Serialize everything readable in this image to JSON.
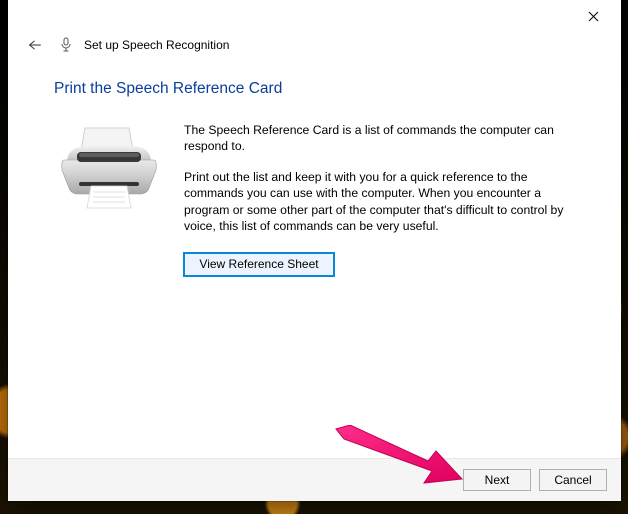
{
  "window": {
    "title": "Set up Speech Recognition"
  },
  "page": {
    "heading": "Print the Speech Reference Card",
    "para1": "The Speech Reference Card is a list of commands the computer can respond to.",
    "para2": "Print out the list and keep it with you for a quick reference to the commands you can use with the computer. When you encounter a program or some other part of the computer that's difficult to control by voice, this list of commands can be very useful.",
    "view_ref_label": "View Reference Sheet"
  },
  "footer": {
    "next_label": "Next",
    "cancel_label": "Cancel"
  }
}
